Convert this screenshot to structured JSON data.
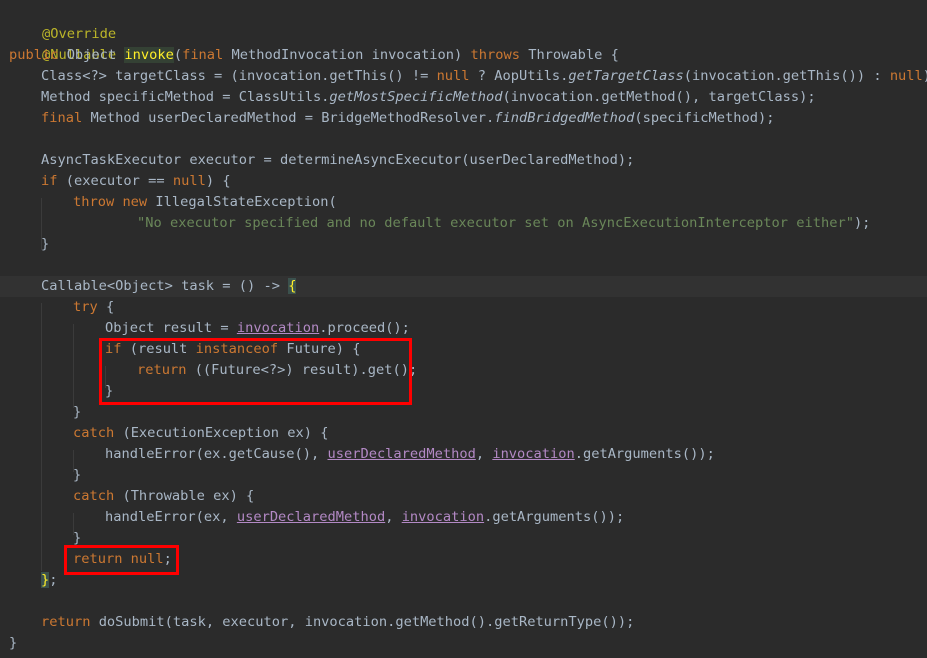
{
  "code": {
    "l1": "@Override",
    "l2": "@Nullable",
    "l3": {
      "kw1": "public ",
      "t1": "Object ",
      "name": "invoke",
      "t2": "(",
      "kw2": "final ",
      "t3": "MethodInvocation invocation) ",
      "kw3": "throws ",
      "t4": "Throwable {"
    },
    "l4": {
      "t1": "Class<?> targetClass = (invocation.getThis() != ",
      "kw1": "null",
      "t2": " ? AopUtils.",
      "it1": "getTargetClass",
      "t3": "(invocation.getThis()) : ",
      "kw2": "null",
      "t4": ");"
    },
    "l5": {
      "t1": "Method specificMethod = ClassUtils.",
      "it1": "getMostSpecificMethod",
      "t2": "(invocation.getMethod(), targetClass);"
    },
    "l6": {
      "kw1": "final ",
      "t1": "Method userDeclaredMethod = BridgeMethodResolver.",
      "it1": "findBridgedMethod",
      "t2": "(specificMethod);"
    },
    "l8": {
      "t1": "AsyncTaskExecutor executor = determineAsyncExecutor(userDeclaredMethod);"
    },
    "l9": {
      "kw1": "if ",
      "t1": "(executor == ",
      "kw2": "null",
      "t2": ") {"
    },
    "l10": {
      "kw1": "throw new ",
      "t1": "IllegalStateException("
    },
    "l11": {
      "str": "\"No executor specified and no default executor set on AsyncExecutionInterceptor either\"",
      "t1": ");"
    },
    "l12": "}",
    "l14": {
      "t1": "Callable<Object> task = () -> ",
      "brace": "{"
    },
    "l15": {
      "kw1": "try ",
      "t1": "{"
    },
    "l16": {
      "t1": "Object result = ",
      "ul1": "invocation",
      "t2": ".proceed();"
    },
    "l17": {
      "kw1": "if ",
      "t1": "(result ",
      "kw2": "instanceof ",
      "t2": "Future) {"
    },
    "l18": {
      "kw1": "return ",
      "t1": "((Future<?>) result).get();"
    },
    "l19": "}",
    "l20": "}",
    "l21": {
      "kw1": "catch ",
      "t1": "(ExecutionException ex) {"
    },
    "l22": {
      "t1": "handleError(ex.getCause(), ",
      "ul1": "userDeclaredMethod",
      "t2": ", ",
      "ul2": "invocation",
      "t3": ".getArguments());"
    },
    "l23": "}",
    "l24": {
      "kw1": "catch ",
      "t1": "(Throwable ex) {"
    },
    "l25": {
      "t1": "handleError(ex, ",
      "ul1": "userDeclaredMethod",
      "t2": ", ",
      "ul2": "invocation",
      "t3": ".getArguments());"
    },
    "l26": "}",
    "l27": {
      "kw1": "return null",
      "t1": ";"
    },
    "l28": {
      "brace": "}",
      "t1": ";"
    },
    "l30": {
      "kw1": "return ",
      "t1": "doSubmit(task, executor, invocation.getMethod().getReturnType());"
    },
    "l31": "}"
  }
}
